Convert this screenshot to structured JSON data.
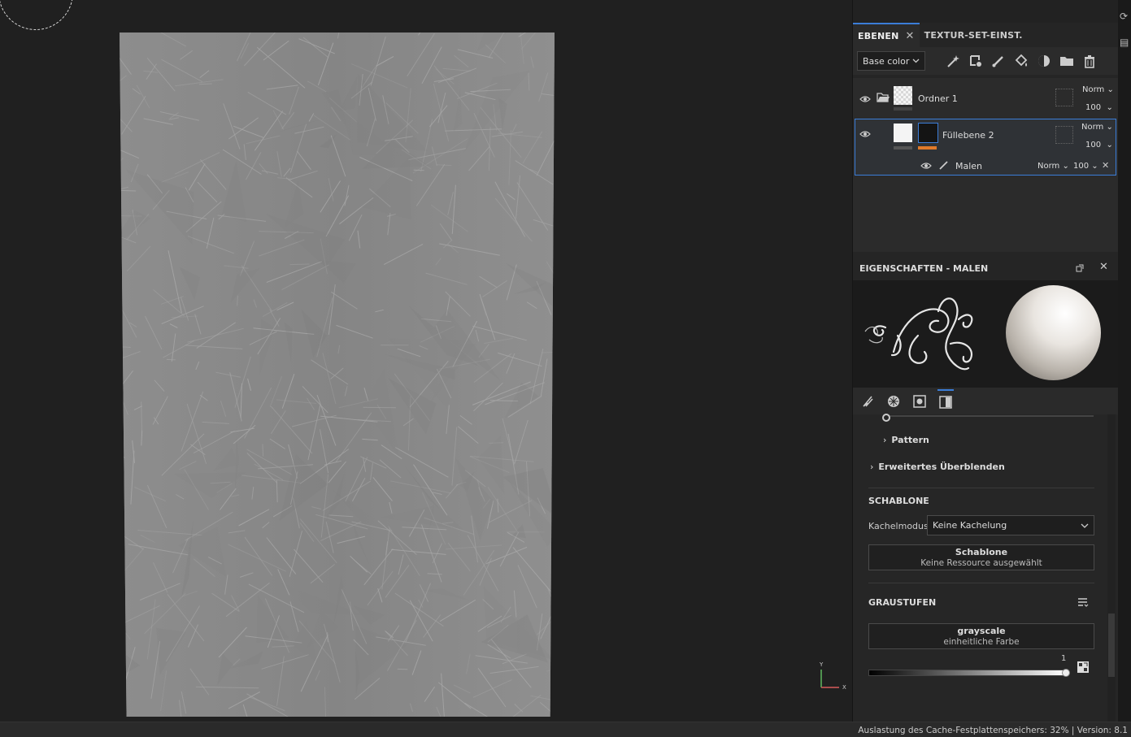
{
  "tabs": {
    "layers": "EBENEN",
    "layers_close": "✕",
    "texture_set": "TEXTUR-SET-EINST."
  },
  "toolbar": {
    "channel": "Base color",
    "icons": [
      "magic-wand-icon",
      "add-effect-icon",
      "paint-layer-icon",
      "fill-layer-icon",
      "mask-icon",
      "folder-icon",
      "trash-icon"
    ]
  },
  "layers": [
    {
      "name": "Ordner 1",
      "blend": "Norm",
      "opacity": "100",
      "type": "folder"
    },
    {
      "name": "Füllebene 2",
      "blend": "Norm",
      "opacity": "100",
      "type": "fill",
      "selected": true,
      "effects": [
        {
          "name": "Malen",
          "blend": "Norm",
          "opacity": "100"
        }
      ]
    }
  ],
  "properties": {
    "title": "EIGENSCHAFTEN - MALEN",
    "rows": {
      "pattern": "Pattern",
      "advanced_blend": "Erweitertes Überblenden"
    },
    "stencil": {
      "title": "SCHABLONE",
      "tiling_label": "Kachelmodus",
      "tiling_value": "Keine Kachelung",
      "resource_title": "Schablone",
      "resource_value": "Keine Ressource ausgewählt"
    },
    "grayscale": {
      "title": "GRAUSTUFEN",
      "resource_title": "grayscale",
      "resource_value": "einheitliche Farbe",
      "value": "1",
      "slider_fraction": 1.0
    }
  },
  "status": "Auslastung des Cache-Festplattenspeichers:   32% | Version: 8.1",
  "gizmo": {
    "y": "Y",
    "x": "X"
  },
  "colors": {
    "accent": "#3b7dd8",
    "orange": "#e07a2a"
  }
}
